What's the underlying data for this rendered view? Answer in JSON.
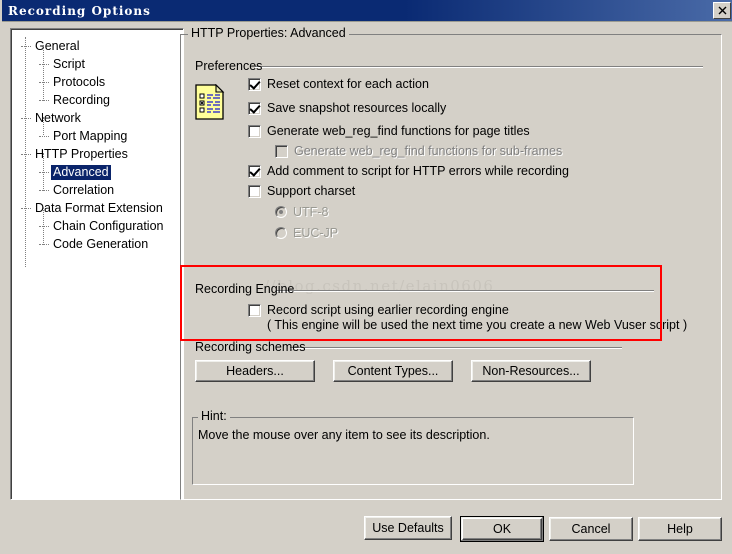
{
  "window": {
    "title": "Recording Options",
    "close_label": "×",
    "close_icon": "close-icon"
  },
  "tree": {
    "items": [
      {
        "label": "General",
        "level": 0,
        "selected": false
      },
      {
        "label": "Script",
        "level": 1,
        "selected": false
      },
      {
        "label": "Protocols",
        "level": 1,
        "selected": false
      },
      {
        "label": "Recording",
        "level": 1,
        "selected": false
      },
      {
        "label": "Network",
        "level": 0,
        "selected": false
      },
      {
        "label": "Port Mapping",
        "level": 1,
        "selected": false
      },
      {
        "label": "HTTP Properties",
        "level": 0,
        "selected": false
      },
      {
        "label": "Advanced",
        "level": 1,
        "selected": true
      },
      {
        "label": "Correlation",
        "level": 1,
        "selected": false
      },
      {
        "label": "Data Format Extension",
        "level": 0,
        "selected": false
      },
      {
        "label": "Chain Configuration",
        "level": 1,
        "selected": false
      },
      {
        "label": "Code Generation",
        "level": 1,
        "selected": false
      }
    ]
  },
  "main_group": {
    "legend": "HTTP Properties: Advanced"
  },
  "preferences": {
    "legend": "Preferences",
    "icon": "document-checklist-icon",
    "checkboxes": [
      {
        "label": "Reset context for each action",
        "checked": true,
        "disabled": false,
        "indent": 0
      },
      {
        "label": "Save snapshot resources locally",
        "checked": true,
        "disabled": false,
        "indent": 0
      },
      {
        "label": "Generate web_reg_find functions for page titles",
        "checked": false,
        "disabled": false,
        "indent": 0
      },
      {
        "label": "Generate web_reg_find functions for sub-frames",
        "checked": false,
        "disabled": true,
        "indent": 1
      },
      {
        "label": "Add comment to script for HTTP errors while recording",
        "checked": true,
        "disabled": false,
        "indent": 0
      },
      {
        "label": "Support charset",
        "checked": false,
        "disabled": false,
        "indent": 0
      }
    ],
    "charset_options": [
      {
        "label": "UTF-8",
        "selected": true,
        "disabled": true
      },
      {
        "label": "EUC-JP",
        "selected": false,
        "disabled": true
      }
    ]
  },
  "recording_engine": {
    "legend": "Recording Engine",
    "checkbox": {
      "label": "Record script using earlier recording engine",
      "checked": false
    },
    "note": "( This engine will be used the next time you create a new Web Vuser script )",
    "highlight_color": "#ff0000"
  },
  "recording_schemes": {
    "legend": "Recording schemes",
    "buttons": [
      {
        "label": "Headers..."
      },
      {
        "label": "Content Types..."
      },
      {
        "label": "Non-Resources..."
      }
    ]
  },
  "hint": {
    "legend": "Hint:",
    "text": "Move the mouse over any item to see its description."
  },
  "footer": {
    "buttons": [
      {
        "label": "Use Defaults",
        "default": false
      },
      {
        "label": "OK",
        "default": true
      },
      {
        "label": "Cancel",
        "default": false
      },
      {
        "label": "Help",
        "default": false
      }
    ]
  },
  "watermark": {
    "text": "//blog.csdn.net/elain0606"
  },
  "colors": {
    "dialog_face": "#d4d0c8",
    "titlebar": "#0a2a73",
    "selection": "#0a246a",
    "highlight": "#ff0000"
  }
}
